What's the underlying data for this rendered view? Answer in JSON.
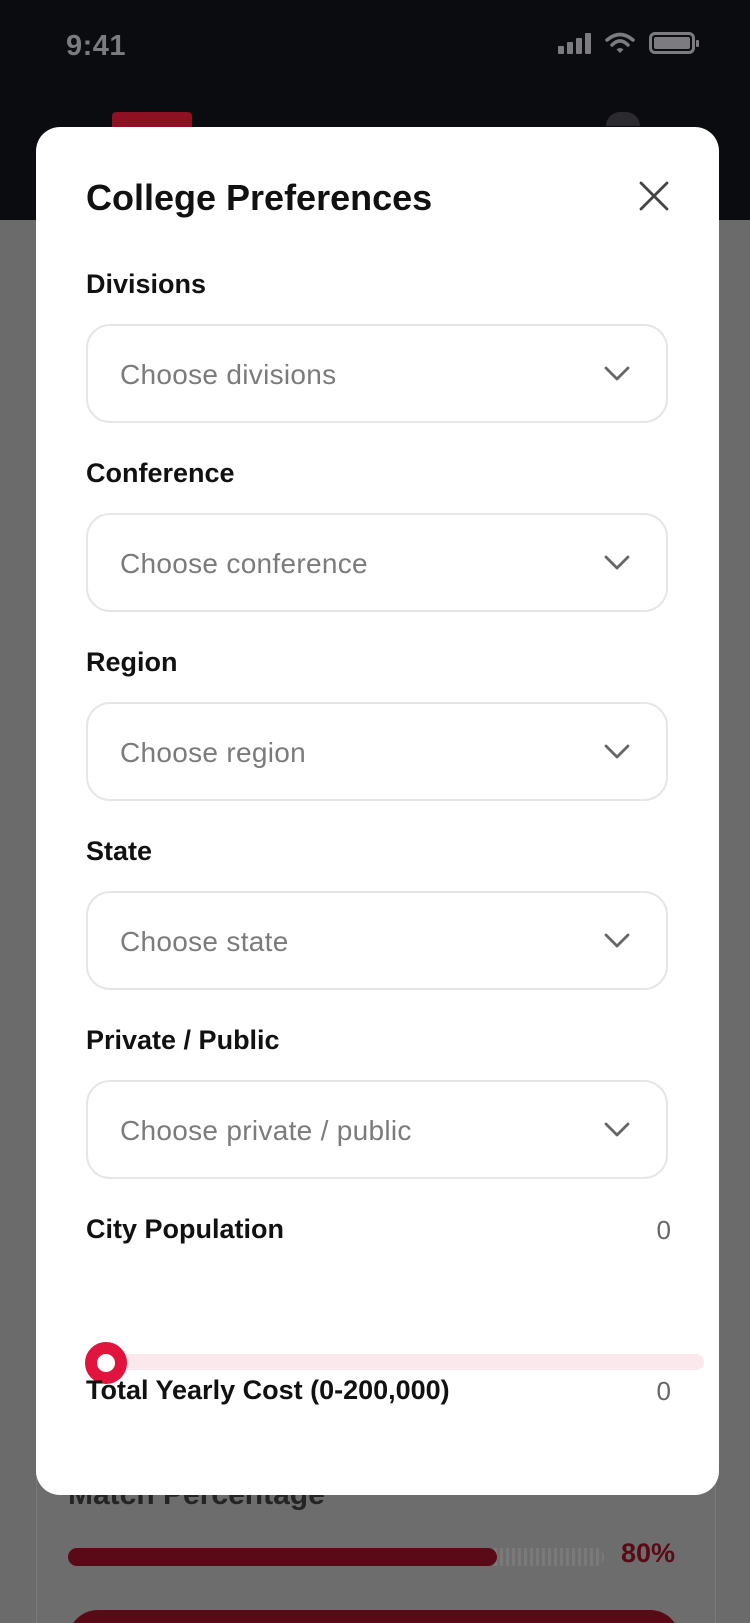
{
  "status_bar": {
    "time": "9:41",
    "icons": [
      "signal-icon",
      "wifi-icon",
      "battery-icon"
    ]
  },
  "modal": {
    "title": "College Preferences",
    "close_icon": "close-icon",
    "fields": [
      {
        "label": "Divisions",
        "placeholder": "Choose divisions"
      },
      {
        "label": "Conference",
        "placeholder": "Choose conference"
      },
      {
        "label": "Region",
        "placeholder": "Choose region"
      },
      {
        "label": "State",
        "placeholder": "Choose state"
      },
      {
        "label": "Private / Public",
        "placeholder": "Choose private / public"
      }
    ],
    "city_population": {
      "label": "City Population",
      "value": "0",
      "slider_fraction": 0
    },
    "total_yearly_cost": {
      "label": "Total Yearly Cost (0-200,000)",
      "value": "0"
    }
  },
  "background": {
    "card_title": "Match Percentage",
    "match_percentage": {
      "value": "80%",
      "fraction": 0.8
    }
  },
  "colors": {
    "accent": "#e0143c",
    "accent_light": "#fbe8ec",
    "brand_dark": "#8d1023",
    "header_bg": "#0b0c10",
    "overlay": "#6b6b6b"
  }
}
